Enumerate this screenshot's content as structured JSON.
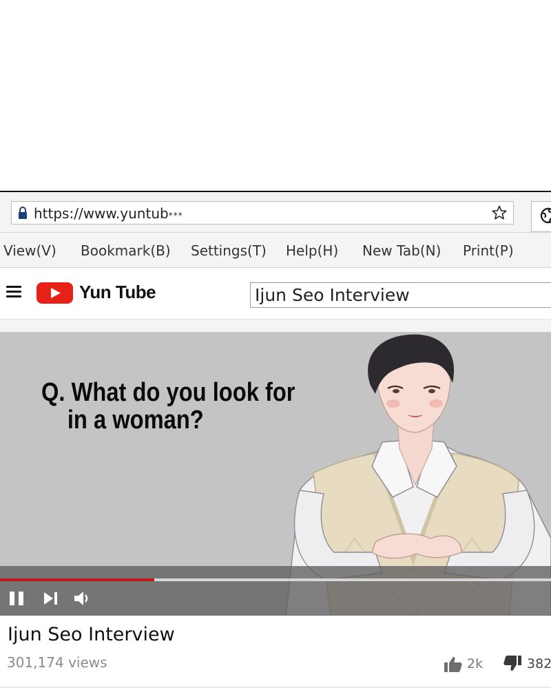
{
  "browser": {
    "url": "https://www.yuntub",
    "url_ellipsis": "***"
  },
  "menu": {
    "items": [
      {
        "label": "View(V)"
      },
      {
        "label": "Bookmark(B)"
      },
      {
        "label": "Settings(T)"
      },
      {
        "label": "Help(H)"
      },
      {
        "label": "New Tab(N)"
      },
      {
        "label": "Print(P)"
      }
    ]
  },
  "site": {
    "logo_text": "Yun Tube",
    "search_value": "Ijun Seo Interview",
    "brand_color": "#e62117"
  },
  "video": {
    "question_line1": "Q. What do you look for",
    "question_line2": "in a woman?",
    "progress": 0.28,
    "progress_color": "#c4161c"
  },
  "info": {
    "title": "Ijun Seo Interview",
    "views": "301,174 views",
    "likes": "2k",
    "dislikes": "382"
  },
  "icons": [
    "lock-icon",
    "star-icon",
    "globe-icon",
    "hamburger-icon",
    "play-logo-icon",
    "pause-icon",
    "next-icon",
    "volume-icon",
    "thumbs-up-icon",
    "thumbs-down-icon"
  ]
}
